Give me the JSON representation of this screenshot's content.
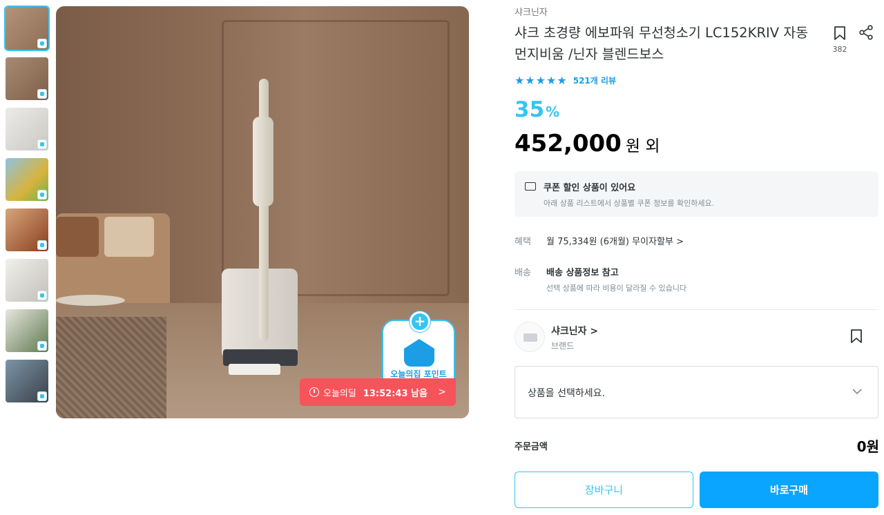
{
  "gallery": {
    "thumbnails": [
      {
        "bg": "#a7886f",
        "active": true
      },
      {
        "bg": "#9e7f68"
      },
      {
        "bg": "#d9d9d6"
      },
      {
        "bg": "#7fb5d6"
      },
      {
        "bg": "#b46f45"
      },
      {
        "bg": "#e3e1dc"
      },
      {
        "bg": "#9aa38d"
      },
      {
        "bg": "#4d5a66"
      }
    ],
    "point_badge_label": "오늘의집 포인트",
    "deal": {
      "label": "오늘의딜",
      "timer": "13:52:43 남음",
      "arrow": ">"
    }
  },
  "product": {
    "brand": "샤크닌자",
    "title": "샤크 초경량 에보파워 무선청소기 LC152KRIV 자동 먼지비움 /닌자 블렌드보스",
    "bookmark_count": "382",
    "rating_stars": 5,
    "reviews": "521개 리뷰",
    "discount": "35",
    "discount_unit": "%",
    "price": "452,000",
    "price_unit": "원 외"
  },
  "coupon": {
    "title": "쿠폰 할인 상품이 있어요",
    "subtitle": "아래 상품 리스트에서 상품별 쿠폰 정보를 확인하세요."
  },
  "benefit": {
    "label": "혜택",
    "value": "월 75,334원 (6개월) 무이자할부 >"
  },
  "shipping": {
    "label": "배송",
    "value": "배송 상품정보 참고",
    "note": "선택 상품에 따라 비용이 달라질 수 있습니다"
  },
  "seller": {
    "name": "샤크닌자 >",
    "type": "브랜드"
  },
  "option_select": {
    "placeholder": "상품을 선택하세요."
  },
  "order": {
    "label": "주문금액",
    "total": "0원"
  },
  "buttons": {
    "cart": "장바구니",
    "buy": "바로구매"
  },
  "colors": {
    "accent": "#35c5f0",
    "buy_button": "#0aa5ff",
    "deal_red": "#f7535b"
  }
}
